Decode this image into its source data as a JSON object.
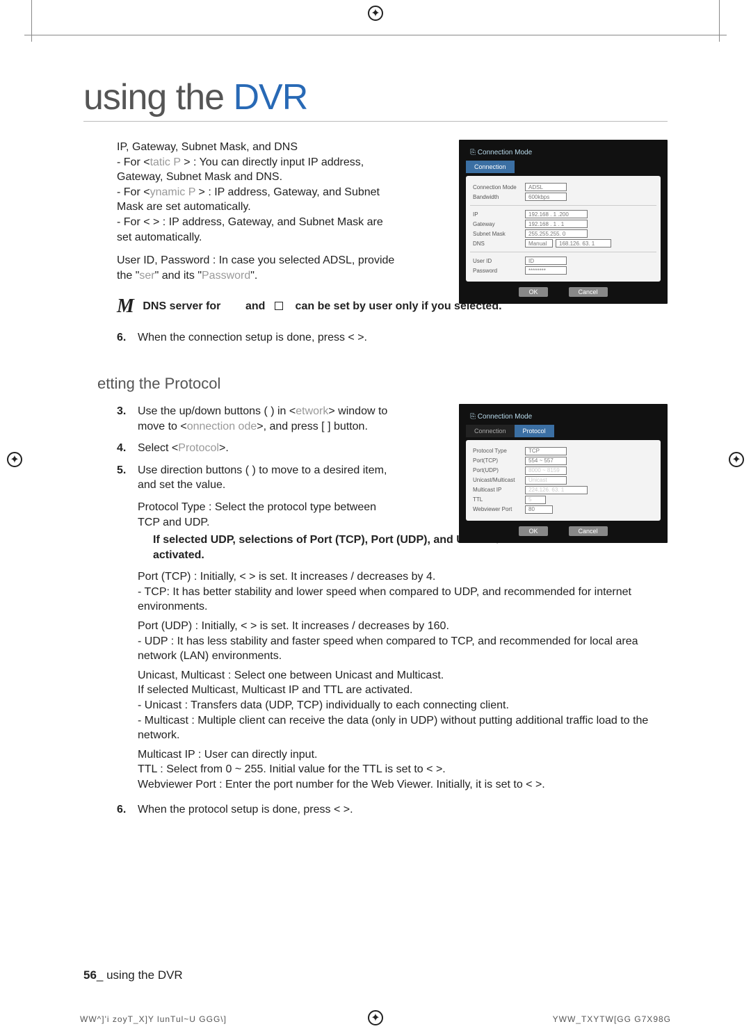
{
  "heading_prefix": "using the ",
  "heading_suffix": "DVR",
  "intro_line": "IP, Gateway, Subnet Mask, and DNS",
  "bullets1": {
    "b1_pre": "For <",
    "b1_gray": "tatic P",
    "b1_post": " > : You can directly input IP address, Gateway, Subnet Mask and DNS.",
    "b2_pre": "For <",
    "b2_gray": "ynamic P",
    "b2_post": " > : IP address, Gateway, and Subnet Mask are set automatically.",
    "b3_pre": "For < ",
    "b3_post": " > : IP address, Gateway, and Subnet Mask are set automatically."
  },
  "user_pw_pre": "User ID, Password : In case you selected ADSL, provide the \"",
  "user_pw_gray1": "ser",
  "user_pw_mid": "\" and its \"",
  "user_pw_gray2": "Password",
  "user_pw_post": "\".",
  "note_m": "M",
  "note_line_1": "DNS server for",
  "note_line_2": "and",
  "note_line_3": "can be set by user only if you selected.",
  "step6a_num": "6.",
  "step6a_text": "When the connection setup is done, press < >.",
  "subheading": "etting the Protocol",
  "step3_num": "3.",
  "step3_text_1": "Use the up/down buttons ( ) in <",
  "step3_gray1": "etwork",
  "step3_text_2": "> window to move to <",
  "step3_gray2": "onnection ode",
  "step3_text_3": ">, and press [ ] button.",
  "step4_num": "4.",
  "step4_text_1": "Select <",
  "step4_gray": "Protocol",
  "step4_text_2": ">.",
  "step5_num": "5.",
  "step5_text": "Use direction buttons ( ) to move to a desired item, and set the value.",
  "ptype_line": "Protocol Type : Select the protocol type between TCP and UDP.",
  "udp_bold": "If selected UDP, selections of Port (TCP), Port (UDP), and Unicast/Multicast are activated.",
  "port_tcp": "Port (TCP) : Initially, < > is set. It increases / decreases by 4.",
  "tcp_sub": "TCP: It has better stability and lower speed when compared to UDP, and recommended for internet environments.",
  "port_udp": "Port (UDP) : Initially, < > is set. It increases / decreases by 160.",
  "udp_sub": "UDP : It has less stability and faster speed when compared to TCP, and recommended for local area network (LAN) environments.",
  "uni_multi_1": "Unicast, Multicast : Select one between Unicast and Multicast.",
  "uni_multi_2": "If selected Multicast, Multicast IP and TTL are activated.",
  "uni_bullet": "Unicast : Transfers data (UDP, TCP) individually to each connecting client.",
  "multi_bullet": "Multicast : Multiple client can receive the data (only in UDP) without putting additional traffic load to the network.",
  "multi_ip": "Multicast IP : User can directly input.",
  "ttl_line": "TTL : Select from 0 ~ 255. Initial value for the TTL is set to < >.",
  "wv_line": "Webviewer Port : Enter the port number for the Web Viewer. Initially, it is set to < >.",
  "step6b_num": "6.",
  "step6b_text": "When the protocol setup is done, press < >.",
  "shot1": {
    "title": "Connection Mode",
    "tab1": "Connection",
    "conn_mode_lbl": "Connection Mode",
    "conn_mode_val": "ADSL",
    "bw_lbl": "Bandwidth",
    "bw_val": "600kbps",
    "ip_lbl": "IP",
    "ip_val": "192.168 . 1 .200",
    "gw_lbl": "Gateway",
    "gw_val": "192.168 . 1 . 1",
    "sm_lbl": "Subnet Mask",
    "sm_val": "255.255.255. 0",
    "dns_lbl": "DNS",
    "dns_mode": "Manual",
    "dns_val": "168.126. 63. 1",
    "uid_lbl": "User ID",
    "uid_val": "ID",
    "pw_lbl": "Password",
    "pw_val": "********",
    "ok": "OK",
    "cancel": "Cancel"
  },
  "shot2": {
    "title": "Connection Mode",
    "tab1": "Connection",
    "tab2": "Protocol",
    "pt_lbl": "Protocol Type",
    "pt_val": "TCP",
    "ptcp_lbl": "Port(TCP)",
    "ptcp_val": "554 ~ 557",
    "pudp_lbl": "Port(UDP)",
    "pudp_val": "8000 ~ 8159",
    "um_lbl": "Unicast/Multicast",
    "um_val": "Unicast",
    "mip_lbl": "Multicast IP",
    "mip_val": "224.126. 63. 1",
    "ttl_lbl": "TTL",
    "ttl_val": "5",
    "wv_lbl": "Webviewer Port",
    "wv_val": "80",
    "ok": "OK",
    "cancel": "Cancel"
  },
  "footer_page": "56",
  "footer_text": "_ using the DVR",
  "bottom_left": "WW^]'i zoyT_X]Y lunTul~U   GGG\\]",
  "bottom_right": "YWW_TXYTW[GG G7X98G"
}
